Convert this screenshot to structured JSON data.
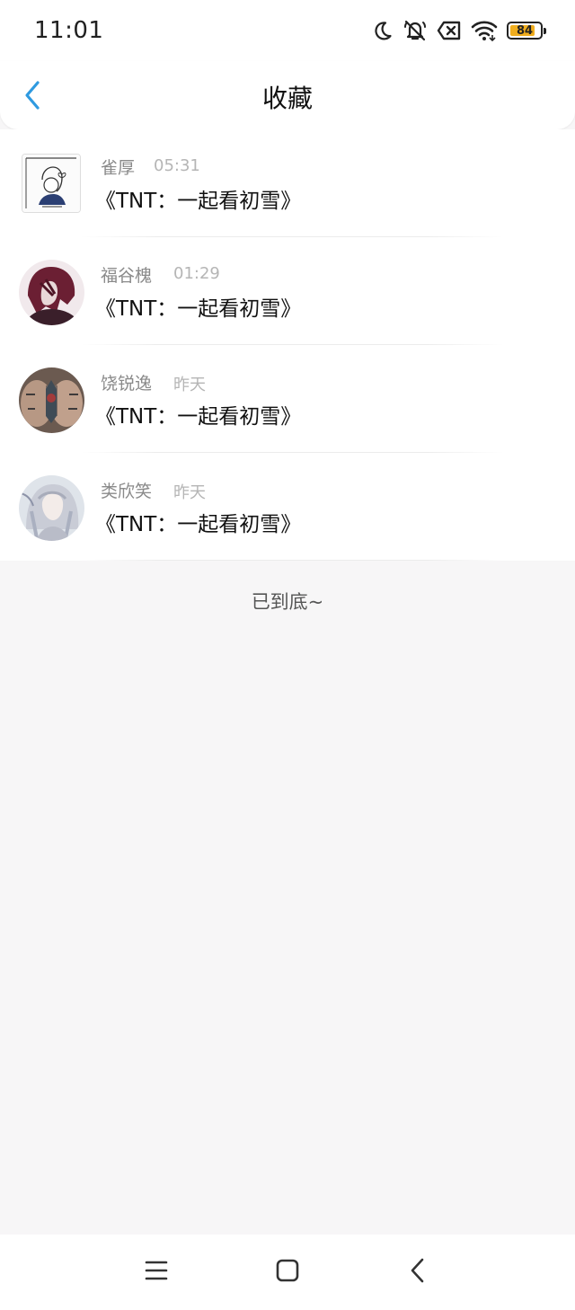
{
  "status_bar": {
    "time": "11:01",
    "battery": "84",
    "battery_level_percent": 84,
    "battery_fill_color": "#f0ad1d",
    "icons": [
      "moon-icon",
      "mute-bell-icon",
      "sim-x-icon",
      "wifi-icon",
      "battery-icon"
    ]
  },
  "header": {
    "title": "收藏",
    "back_icon": "chevron-left-icon",
    "accent_color": "#2f9ae0"
  },
  "items": [
    {
      "name": "雀厚",
      "time": "05:31",
      "title": "《TNT：一起看初雪》",
      "avatar_icon": "sketch-avatar"
    },
    {
      "name": "福谷槐",
      "time": "01:29",
      "title": "《TNT：一起看初雪》",
      "avatar_icon": "red-hair-avatar"
    },
    {
      "name": "饶锐逸",
      "time": "昨天",
      "title": "《TNT：一起看初雪》",
      "avatar_icon": "hands-avatar"
    },
    {
      "name": "类欣笑",
      "time": "昨天",
      "title": "《TNT：一起看初雪》",
      "avatar_icon": "silver-hair-avatar"
    }
  ],
  "footer": {
    "end_text": "已到底~"
  },
  "nav_bar": {
    "buttons": [
      "menu-icon",
      "home-icon",
      "back-icon"
    ]
  }
}
